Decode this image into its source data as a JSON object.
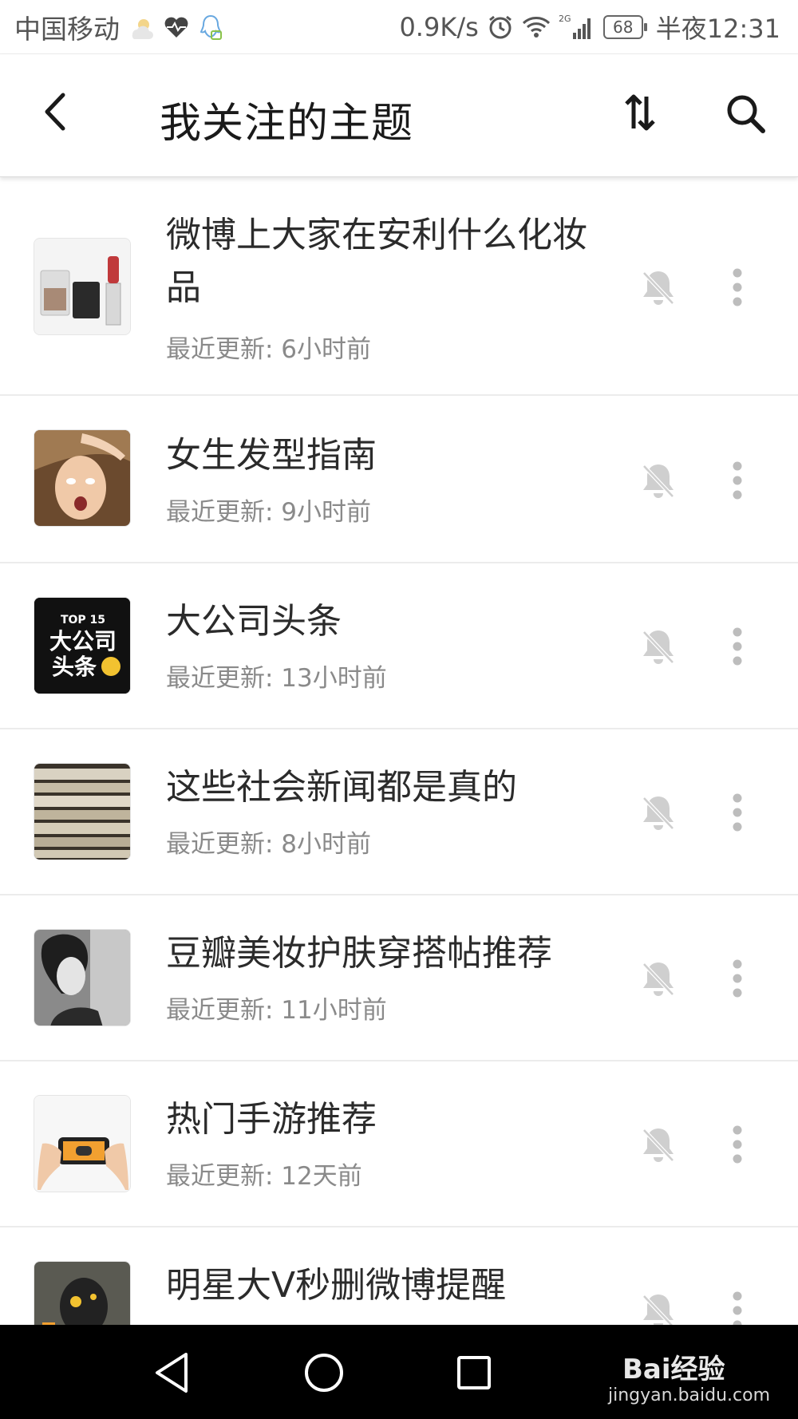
{
  "status_bar": {
    "carrier": "中国移动",
    "net_speed": "0.9K/s",
    "network_type": "2G",
    "battery": "68",
    "time": "半夜12:31",
    "icons": [
      "weather-icon",
      "health-icon",
      "qq-icon",
      "alarm-icon",
      "wifi-icon",
      "signal-icon",
      "battery-icon"
    ]
  },
  "header": {
    "title": "我关注的主题",
    "icons": [
      "back-arrow-icon",
      "sort-icon",
      "search-icon"
    ]
  },
  "topics": [
    {
      "title": "微博上大家在安利什么化妆品",
      "updated": "最近更新: 6小时前",
      "thumb_icon": "cosmetics-thumbnail"
    },
    {
      "title": "女生发型指南",
      "updated": "最近更新: 9小时前",
      "thumb_icon": "hairstyle-thumbnail"
    },
    {
      "title": "大公司头条",
      "updated": "最近更新: 13小时前",
      "thumb_icon": "company-news-thumbnail",
      "thumb_text_top": "TOP 15",
      "thumb_text_main1": "大公司",
      "thumb_text_main2": "头条"
    },
    {
      "title": "这些社会新闻都是真的",
      "updated": "最近更新: 8小时前",
      "thumb_icon": "newspapers-thumbnail"
    },
    {
      "title": "豆瓣美妆护肤穿搭帖推荐",
      "updated": "最近更新: 11小时前",
      "thumb_icon": "portrait-thumbnail"
    },
    {
      "title": "热门手游推荐",
      "updated": "最近更新: 12天前",
      "thumb_icon": "mobile-game-thumbnail"
    },
    {
      "title": "明星大V秒删微博提醒",
      "updated": "",
      "thumb_icon": "celebrity-thumbnail"
    }
  ],
  "nav_bar": {
    "icons": [
      "nav-back-icon",
      "nav-home-icon",
      "nav-recents-icon"
    ]
  },
  "watermark": {
    "brand": "Bai经验",
    "url": "jingyan.baidu.com"
  },
  "colors": {
    "title_text": "#2b2b2b",
    "meta_text": "#8a8a8a",
    "divider": "#ececec",
    "icon_gray": "#cfcfcf",
    "nav_bar": "#000000"
  }
}
